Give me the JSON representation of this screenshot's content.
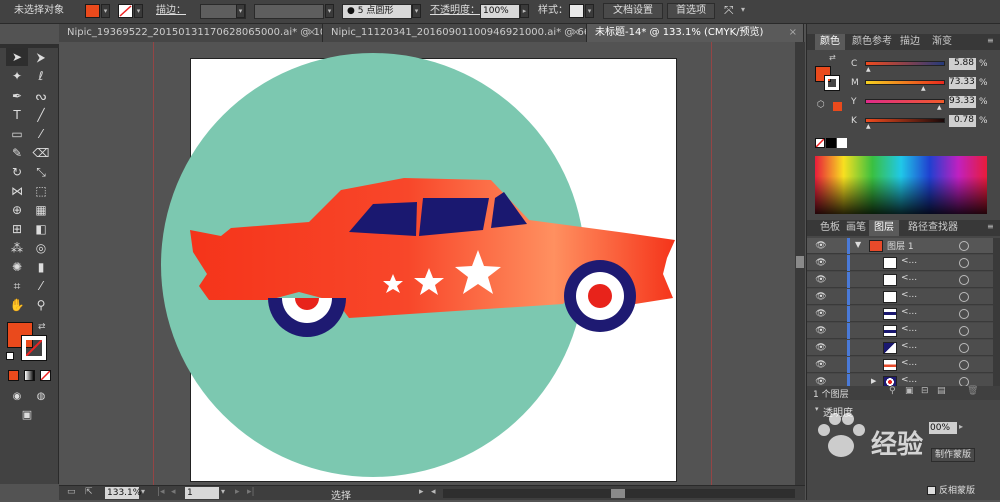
{
  "control_bar": {
    "selection_status": "未选择对象",
    "stroke_label": "描边：",
    "brush_label": "5 点圆形",
    "opacity_label": "不透明度：",
    "opacity_value": "100%",
    "style_label": "样式：",
    "doc_setup_button": "文档设置",
    "preferences_button": "首选项",
    "fill_color": "#ea4a1c"
  },
  "tabs": [
    {
      "label": "Nipic_19369522_20150131170628065000.ai* @ 10..."
    },
    {
      "label": "Nipic_11120341_20160901100946921000.ai* @ 66..."
    },
    {
      "label": "未标题-14* @ 133.1% (CMYK/预览)"
    }
  ],
  "tools": {
    "fill_color": "#ea4a1c"
  },
  "canvas": {
    "circle_color": "#7cc8b0",
    "car_color": "#f03a1e",
    "window_color": "#1a1870",
    "wheel_color": "#1e1a72"
  },
  "status_bar": {
    "zoom": "133.1%",
    "page": "1",
    "tool_name": "选择"
  },
  "color_panel": {
    "tabs": [
      "颜色",
      "颜色参考",
      "描边",
      "渐变"
    ],
    "channels": [
      {
        "label": "C",
        "value": "5.88",
        "fraction": 0.06
      },
      {
        "label": "M",
        "value": "73.33",
        "fraction": 0.73
      },
      {
        "label": "Y",
        "value": "93.33",
        "fraction": 0.93
      },
      {
        "label": "K",
        "value": "0.78",
        "fraction": 0.01
      }
    ],
    "percent_sign": "%"
  },
  "layers_panel": {
    "tabs": [
      "色板",
      "画笔",
      "图层",
      "路径查找器"
    ],
    "layer_name": "图层 1",
    "sublayer_label": "<...",
    "layer_count": "1 个图层"
  },
  "transparency_panel": {
    "title": "透明度",
    "opacity_value": "00%",
    "make_mask_button": "制作蒙版",
    "invert_mask_label": "反相蒙版"
  },
  "watermark": {
    "text": "经验"
  }
}
